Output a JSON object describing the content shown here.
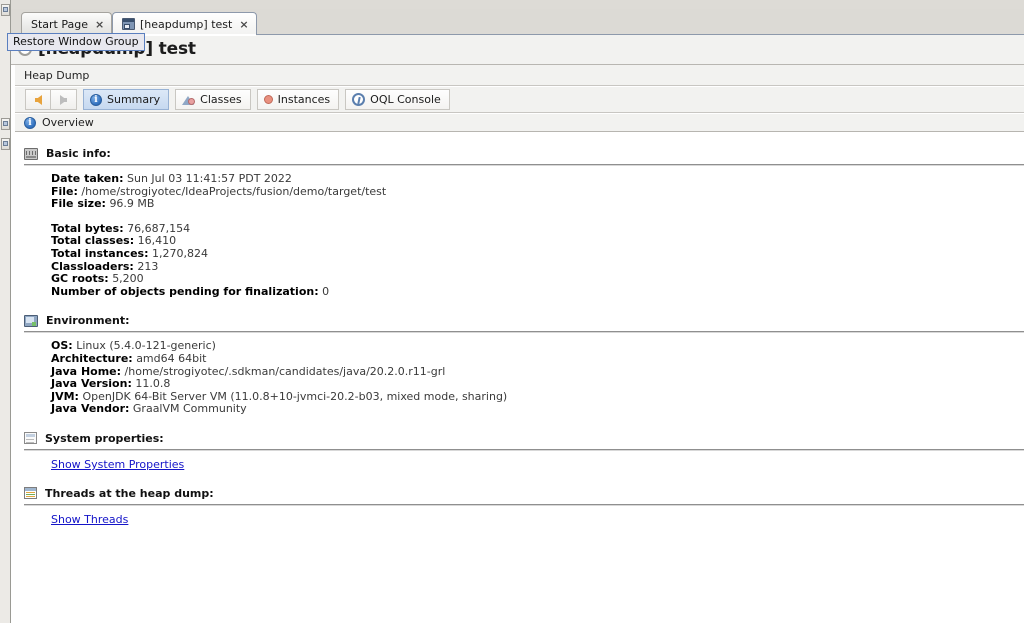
{
  "window": {
    "tabs": [
      {
        "label": "Start Page",
        "close": "×",
        "active": false,
        "icon": "none"
      },
      {
        "label": "[heapdump] test",
        "close": "×",
        "active": true,
        "icon": "heapdump-icon"
      }
    ]
  },
  "tooltip": {
    "text": "Restore Window Group"
  },
  "page": {
    "title": "[heapdump] test"
  },
  "panel": {
    "caption": "Heap Dump"
  },
  "toolbar": {
    "back_label": "",
    "forward_label": "",
    "buttons": [
      {
        "label": "Summary",
        "icon": "info-icon",
        "selected": true
      },
      {
        "label": "Classes",
        "icon": "classes-icon",
        "selected": false
      },
      {
        "label": "Instances",
        "icon": "instance-icon",
        "selected": false
      },
      {
        "label": "OQL Console",
        "icon": "oql-icon",
        "selected": false
      }
    ]
  },
  "overview": {
    "label": "Overview",
    "icon": "info-icon"
  },
  "sections": {
    "basic": {
      "title": "Basic info:",
      "icon": "basic-info-icon",
      "rows": [
        {
          "key": "Date taken:",
          "value": "Sun Jul 03 11:41:57 PDT 2022"
        },
        {
          "key": "File:",
          "value": "/home/strogiyotec/IdeaProjects/fusion/demo/target/test"
        },
        {
          "key": "File size:",
          "value": "96.9 MB"
        }
      ],
      "rows2": [
        {
          "key": "Total bytes:",
          "value": "76,687,154"
        },
        {
          "key": "Total classes:",
          "value": "16,410"
        },
        {
          "key": "Total instances:",
          "value": "1,270,824"
        },
        {
          "key": "Classloaders:",
          "value": "213"
        },
        {
          "key": "GC roots:",
          "value": "5,200"
        },
        {
          "key": "Number of objects pending for finalization:",
          "value": "0"
        }
      ]
    },
    "environment": {
      "title": "Environment:",
      "icon": "environment-icon",
      "rows": [
        {
          "key": "OS:",
          "value": "Linux (5.4.0-121-generic)"
        },
        {
          "key": "Architecture:",
          "value": "amd64 64bit"
        },
        {
          "key": "Java Home:",
          "value": "/home/strogiyotec/.sdkman/candidates/java/20.2.0.r11-grl"
        },
        {
          "key": "Java Version:",
          "value": "11.0.8"
        },
        {
          "key": "JVM:",
          "value": "OpenJDK 64-Bit Server VM (11.0.8+10-jvmci-20.2-b03, mixed mode, sharing)"
        },
        {
          "key": "Java Vendor:",
          "value": "GraalVM Community"
        }
      ]
    },
    "system_properties": {
      "title": "System properties:",
      "icon": "system-properties-icon",
      "link": "Show System Properties"
    },
    "threads": {
      "title": "Threads at the heap dump:",
      "icon": "threads-icon",
      "link": "Show Threads"
    }
  },
  "colors": {
    "link": "#1414c8",
    "selected_tab": "#c6d9f0",
    "tooltip_border": "#5a7fbf",
    "back_arrow": "#e8a33d"
  }
}
